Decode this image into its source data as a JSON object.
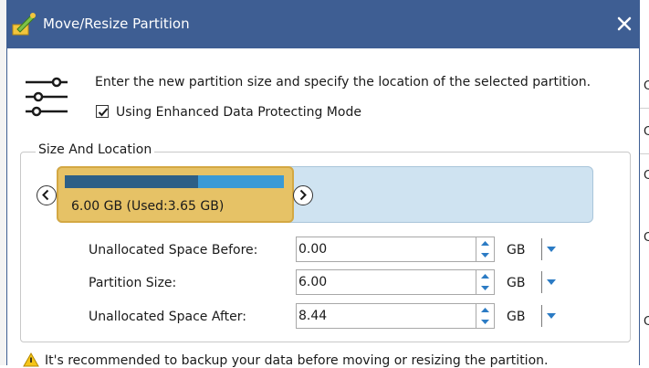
{
  "dialog": {
    "title": "Move/Resize Partition",
    "close_icon": "close-icon",
    "app_icon": "partition-wizard-icon"
  },
  "header": {
    "settings_icon": "sliders-icon",
    "description": "Enter the new partition size and specify the location of the selected partition.",
    "enhanced_mode_label": "Using Enhanced Data Protecting Mode",
    "enhanced_mode_checked": true
  },
  "size_location": {
    "group_title": "Size And Location",
    "partition_label": "6.00 GB (Used:3.65 GB)",
    "used_fraction": 0.61,
    "colors": {
      "track": "#cfe3f1",
      "partition": "#e6c266",
      "used": "#2d5f86",
      "free": "#3a9ad6"
    },
    "fields": [
      {
        "label": "Unallocated Space Before:",
        "value": "0.00",
        "unit": "GB"
      },
      {
        "label": "Partition Size:",
        "value": "6.00",
        "unit": "GB"
      },
      {
        "label": "Unallocated Space After:",
        "value": "8.44",
        "unit": "GB"
      }
    ]
  },
  "warning": {
    "icon": "warning-icon",
    "text": "It's recommended to backup your data before moving or resizing the partition."
  },
  "background": {
    "right_fragments": [
      "C",
      "C",
      "C",
      "C",
      "C"
    ]
  }
}
